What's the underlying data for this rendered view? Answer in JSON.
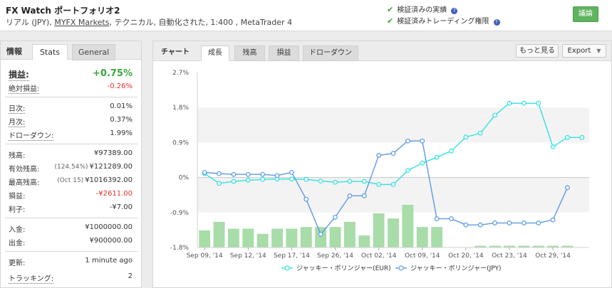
{
  "header": {
    "title": "FX Watch ポートフォリオ2",
    "account_type": "リアル (JPY), ",
    "broker_link": "MYFX Markets",
    "details": ", テクニカル, 自動化された, 1:400 , MetaTrader 4",
    "verified_track": "検証済みの実績",
    "verified_trading": "検証済みトレーディング権限",
    "discuss_button": "議論",
    "help_glyph": "?"
  },
  "left_panel": {
    "title": "情報",
    "tab_stats": "Stats",
    "tab_general": "General",
    "rows": {
      "gain": {
        "k": "損益:",
        "v": "+0.75%"
      },
      "abs_gain": {
        "k": "絶対損益:",
        "v": "-0.26%"
      },
      "daily": {
        "k": "日次:",
        "v": "0.01%"
      },
      "monthly": {
        "k": "月次:",
        "v": "0.37%"
      },
      "drawdown": {
        "k": "ドローダウン:",
        "v": "1.99%"
      },
      "balance": {
        "k": "残高:",
        "v": "¥97389.00"
      },
      "equity": {
        "k": "有効残高:",
        "pct": "(124.54%)",
        "v": "¥121289.00"
      },
      "highest": {
        "k": "最高残高:",
        "pct": "(Oct 15)",
        "v": "¥1016392.00"
      },
      "profit": {
        "k": "損益:",
        "v": "-¥2611.00"
      },
      "interest": {
        "k": "利子:",
        "v": "-¥7.00"
      },
      "deposits": {
        "k": "入金:",
        "v": "¥1000000.00"
      },
      "withdrawals": {
        "k": "出金:",
        "v": "¥900000.00"
      },
      "updated": {
        "k": "更新:",
        "v": "1 minute ago"
      },
      "tracking": {
        "k": "トラッキング:",
        "v": "2"
      }
    }
  },
  "right_panel": {
    "label": "チャート",
    "tabs": [
      "成長",
      "残高",
      "損益",
      "ドローダウン"
    ],
    "more_button": "もっと見る",
    "export_button": "Export",
    "export_caret": "▼"
  },
  "colors": {
    "eur_line": "#33e0e0",
    "jpy_line": "#5b9be6",
    "bars": "#a8dca8",
    "positive": "#3aa63a",
    "negative": "#e2322d"
  },
  "chart_data": {
    "type": "line",
    "y_ticks": [
      "2.7%",
      "1.8%",
      "0.9%",
      "0%",
      "-0.9%",
      "-1.8%"
    ],
    "y_values": [
      2.7,
      1.8,
      0.9,
      0,
      -0.9,
      -1.8
    ],
    "ylim": [
      -1.8,
      2.7
    ],
    "x_ticks": [
      "Sep 09, '14",
      "Sep 12, '14",
      "Sep 17, '14",
      "Sep 26, '14",
      "Oct 02, '14",
      "Oct 09, '14",
      "Oct 20, '14",
      "Oct 23, '14",
      "Oct 29, '14"
    ],
    "x_tick_index": [
      0,
      3,
      6,
      9,
      12,
      15,
      18,
      21,
      24
    ],
    "series": [
      {
        "name": "ジャッキー・ボリンジャー(EUR)",
        "values": [
          0.1,
          -0.15,
          -0.1,
          -0.07,
          -0.05,
          -0.04,
          -0.04,
          -0.05,
          -0.09,
          -0.12,
          -0.1,
          -0.1,
          -0.18,
          -0.18,
          0.18,
          0.37,
          0.52,
          0.68,
          1.04,
          1.14,
          1.6,
          1.91,
          1.91,
          1.91,
          0.79,
          1.03,
          1.03
        ]
      },
      {
        "name": "ジャッキー・ボリンジャー(JPY)",
        "values": [
          0.13,
          0.1,
          0.08,
          0.08,
          0.08,
          0.05,
          0.13,
          -0.56,
          -1.46,
          -1.02,
          -0.47,
          -0.47,
          0.57,
          0.62,
          0.94,
          0.94,
          -1.06,
          -1.06,
          -1.22,
          -1.22,
          -1.17,
          -1.17,
          -1.17,
          -1.17,
          -1.09,
          -0.26
        ]
      }
    ],
    "bars": [
      10,
      15,
      11,
      11,
      8,
      11,
      11,
      12,
      12,
      12,
      15,
      7,
      20,
      17,
      25,
      12,
      12,
      0,
      0,
      1,
      1,
      1,
      1,
      1,
      1,
      1
    ]
  }
}
